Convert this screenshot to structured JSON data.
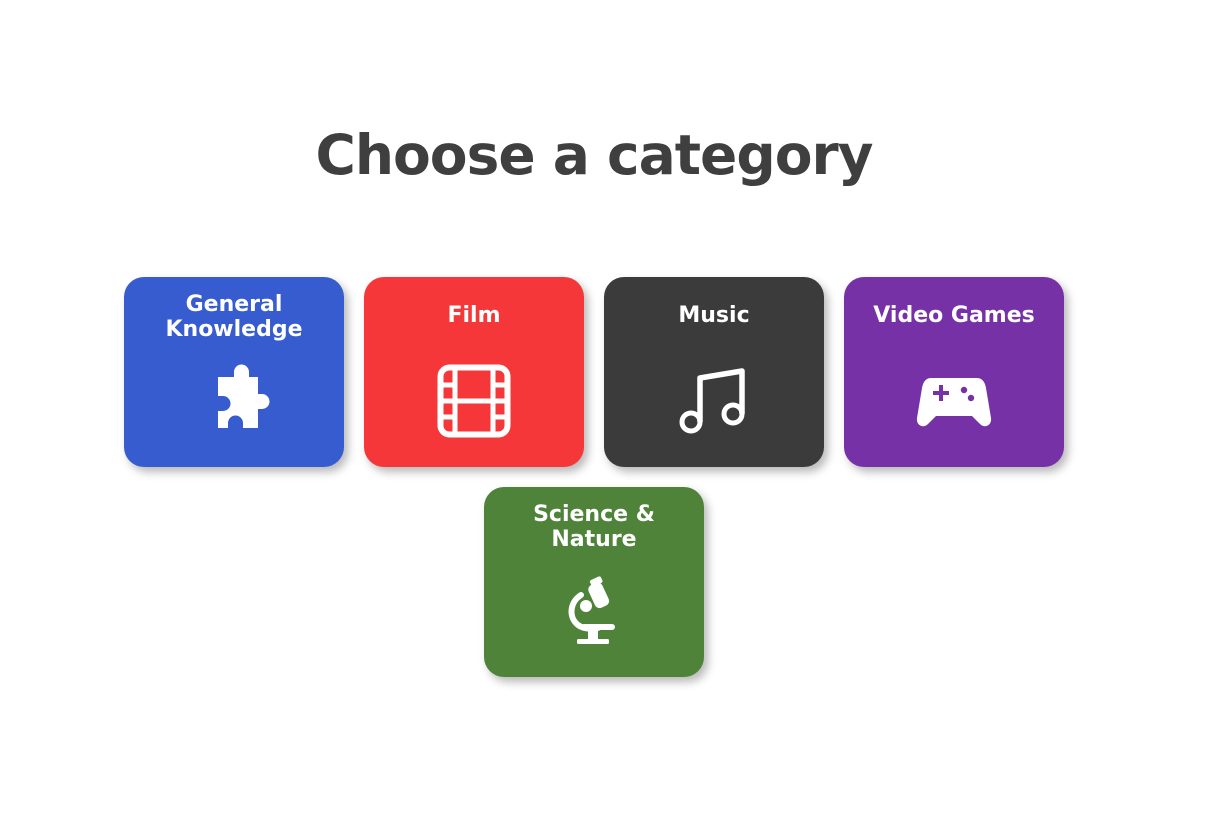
{
  "page": {
    "title": "Choose a category"
  },
  "categories": [
    {
      "label": "General Knowledge",
      "icon": "puzzle-piece-icon",
      "color": "#375ccf"
    },
    {
      "label": "Film",
      "icon": "film-strip-icon",
      "color": "#f5373a"
    },
    {
      "label": "Music",
      "icon": "music-note-icon",
      "color": "#3b3b3b"
    },
    {
      "label": "Video Games",
      "icon": "gamepad-icon",
      "color": "#7731a7"
    },
    {
      "label": "Science & Nature",
      "icon": "microscope-icon",
      "color": "#4f833a"
    }
  ],
  "colors": {
    "title_text": "#3f3f3f",
    "card_text": "#ffffff",
    "background": "#ffffff"
  }
}
